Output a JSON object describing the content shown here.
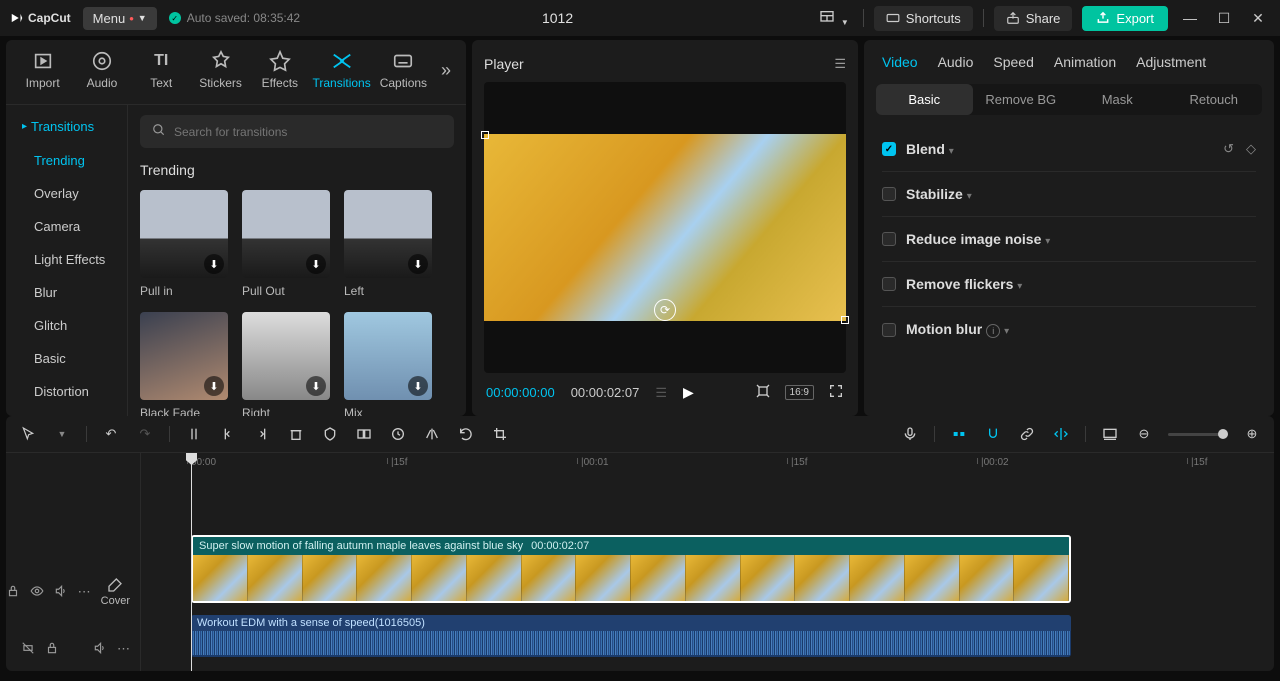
{
  "app": {
    "name": "CapCut",
    "menu": "Menu",
    "autosave": "Auto saved: 08:35:42",
    "project": "1012"
  },
  "topbar": {
    "shortcuts": "Shortcuts",
    "share": "Share",
    "export": "Export"
  },
  "toolTabs": [
    {
      "label": "Import"
    },
    {
      "label": "Audio"
    },
    {
      "label": "Text"
    },
    {
      "label": "Stickers"
    },
    {
      "label": "Effects"
    },
    {
      "label": "Transitions"
    },
    {
      "label": "Captions"
    }
  ],
  "sidebar": {
    "heading": "Transitions",
    "items": [
      "Trending",
      "Overlay",
      "Camera",
      "Light Effects",
      "Blur",
      "Glitch",
      "Basic",
      "Distortion"
    ],
    "active": 0
  },
  "search": {
    "placeholder": "Search for transitions"
  },
  "section": {
    "title": "Trending"
  },
  "cards": [
    {
      "label": "Pull in"
    },
    {
      "label": "Pull Out"
    },
    {
      "label": "Left"
    },
    {
      "label": "Black Fade"
    },
    {
      "label": "Right"
    },
    {
      "label": "Mix"
    }
  ],
  "player": {
    "title": "Player",
    "current": "00:00:00:00",
    "duration": "00:00:02:07",
    "ratio": "16:9"
  },
  "rightTabs": [
    "Video",
    "Audio",
    "Speed",
    "Animation",
    "Adjustment"
  ],
  "subTabs": [
    "Basic",
    "Remove BG",
    "Mask",
    "Retouch"
  ],
  "props": {
    "blend": "Blend",
    "stabilize": "Stabilize",
    "noise": "Reduce image noise",
    "flicker": "Remove flickers",
    "motion": "Motion blur"
  },
  "timeline": {
    "marks": [
      {
        "pos": 50,
        "label": "00:00"
      },
      {
        "pos": 250,
        "label": "|15f"
      },
      {
        "pos": 440,
        "label": "|00:01"
      },
      {
        "pos": 650,
        "label": "|15f"
      },
      {
        "pos": 840,
        "label": "|00:02"
      },
      {
        "pos": 1050,
        "label": "|15f"
      }
    ],
    "clip": {
      "name": "Super slow motion of falling autumn maple leaves against blue sky",
      "dur": "00:00:02:07"
    },
    "audio": {
      "name": "Workout EDM with a sense of speed(1016505)"
    },
    "cover": "Cover"
  }
}
